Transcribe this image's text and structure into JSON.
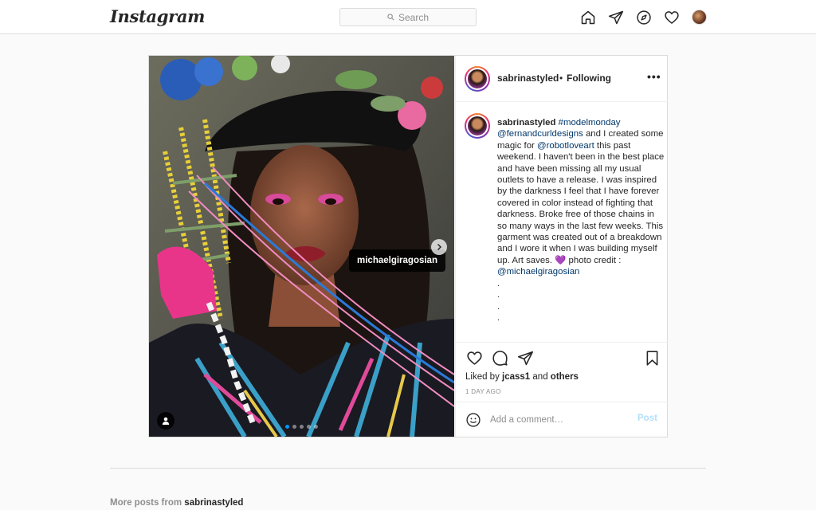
{
  "nav": {
    "logo": "Instagram",
    "search_placeholder": "Search",
    "icons": [
      "home-icon",
      "direct-icon",
      "explore-icon",
      "activity-heart-icon",
      "profile-avatar"
    ]
  },
  "post": {
    "username": "sabrinastyled",
    "separator": "•",
    "follow_status": "Following",
    "more_label": "•••",
    "photo_tag": "michaelgiragosian",
    "caption": {
      "username": "sabrinastyled",
      "hashtag": "#modelmonday",
      "mention1": "@fernandcurldesigns",
      "text1": " and I created some magic for ",
      "mention2": "@robotloveart",
      "text2": " this past weekend. I haven't been in the best place and have been missing all my usual outlets to have a release. I was inspired by the darkness I feel that I have forever covered in color instead of fighting that darkness. Broke free of those chains in so many ways in the last few weeks. This garment was created out of a breakdown and I wore it when I was building myself up. Art saves. 💜 photo credit : ",
      "mention3": "@michaelgiragosian",
      "trailing": ".\n.\n.\n."
    },
    "liked_prefix": "Liked by ",
    "liked_user": "jcass1",
    "liked_and": " and ",
    "liked_others": "others",
    "time_ago": "1 DAY AGO",
    "comment_placeholder": "Add a comment…",
    "post_button": "Post",
    "carousel": {
      "count": 5,
      "active": 1
    }
  },
  "more_posts": {
    "prefix": "More posts from ",
    "username": "sabrinastyled"
  }
}
